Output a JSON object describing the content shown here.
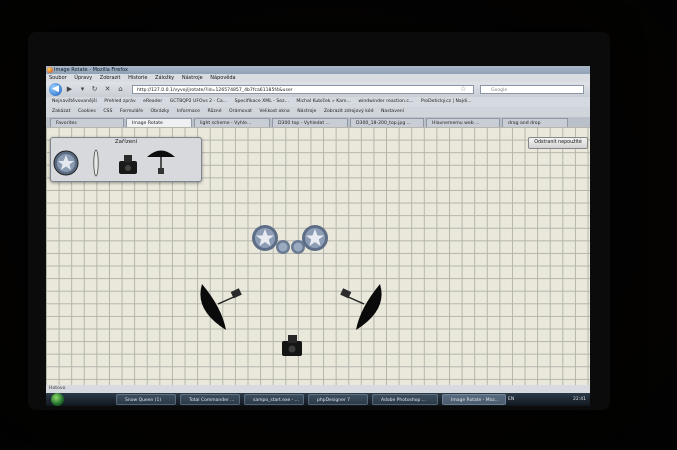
{
  "window": {
    "title": "Image Rotate - Mozilla Firefox"
  },
  "menu": {
    "items": [
      "Soubor",
      "Úpravy",
      "Zobrazit",
      "Historie",
      "Záložky",
      "Nástroje",
      "Nápověda"
    ]
  },
  "nav": {
    "url": "http://127.0.0.1/vyvoj/jrotate/?id=126574857_4b7fca61185f4&user",
    "search_placeholder": "Google"
  },
  "bookmarks": {
    "row1": [
      "Nejnavštěvovanější",
      "Přehled zpráv",
      "eReader",
      "GCT8QP2 UFOvs 2 - Ca...",
      "Specifikace XML - Sez...",
      "Michal Kubíček » Kam...",
      "windwinder reaction.c...",
      "ProDetický.cz | Najdi..."
    ],
    "row2": [
      "Zakázat",
      "Cookies",
      "CSS",
      "Formuláře",
      "Obrázky",
      "Informace",
      "Různé",
      "Orámovat",
      "Velikost okna",
      "Nástroje",
      "Zobrazit zdrojový kód",
      "Nastavení"
    ]
  },
  "tabs": [
    "Favorites",
    "Image Rotate",
    "light scheme - Vyhle...",
    "D300 top - Vyhledat ...",
    "D300_18-200_top.jpg ...",
    "Hlavnememu web ...",
    "drag and drop"
  ],
  "content": {
    "panel_title": "Zařízení",
    "remove_button": "Odstranit nepoužité"
  },
  "status": {
    "text": "Hotovo"
  },
  "taskbar": {
    "items": [
      "Snow Queen (1)",
      "Total Commander ...",
      "sampo_start.exe - ...",
      "phpDesigner 7",
      "Adobe Photoshop ...",
      "Image Rotate - Moz..."
    ],
    "lang": "EN",
    "clock": "22:41"
  },
  "icons": {
    "back": "back-arrow-icon",
    "forward": "forward-arrow-icon",
    "reload": "reload-icon",
    "home": "home-icon",
    "bookmark_star": "star-icon",
    "search": "search-icon",
    "start": "windows-start-icon"
  }
}
